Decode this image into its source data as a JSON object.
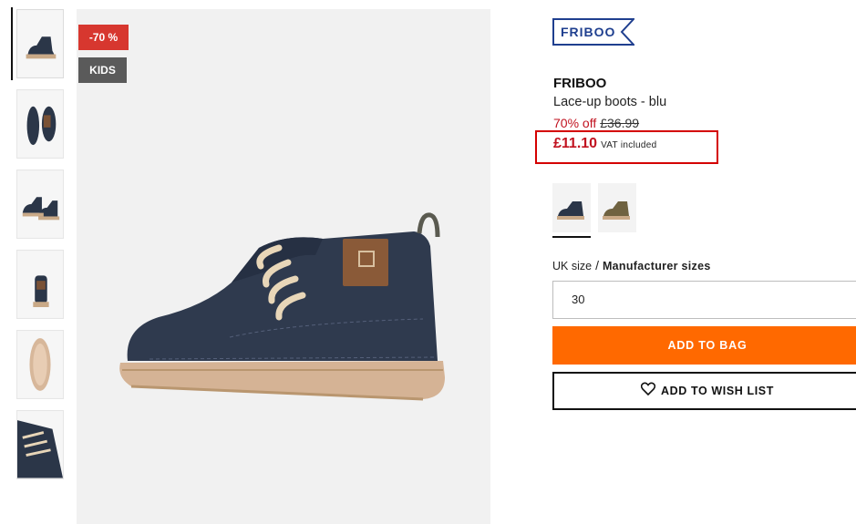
{
  "gallery": {
    "thumbnails": [
      {
        "label": "side view"
      },
      {
        "label": "top view"
      },
      {
        "label": "pair view"
      },
      {
        "label": "back view"
      },
      {
        "label": "sole view"
      },
      {
        "label": "detail view"
      }
    ]
  },
  "badges": {
    "discount": "-70 %",
    "category": "KIDS"
  },
  "product": {
    "brand_logo_text": "FRIBOO",
    "brand": "FRIBOO",
    "name": "Lace-up boots - blu",
    "discount_percent": "70% off",
    "original_price": "£36.99",
    "price": "£11.10",
    "vat_note": "VAT included"
  },
  "colors": {
    "accent": "#ff6900",
    "sale": "#c1121f",
    "brand": "#1f3f8f",
    "swatches": [
      {
        "name": "navy",
        "hex": "#2b3648"
      },
      {
        "name": "olive",
        "hex": "#6f6240"
      }
    ]
  },
  "size": {
    "label": "UK size",
    "separator": "/",
    "manufacturer_label": "Manufacturer sizes",
    "selected": "30"
  },
  "actions": {
    "add_to_bag": "ADD TO BAG",
    "add_to_wishlist": "ADD TO WISH LIST"
  }
}
